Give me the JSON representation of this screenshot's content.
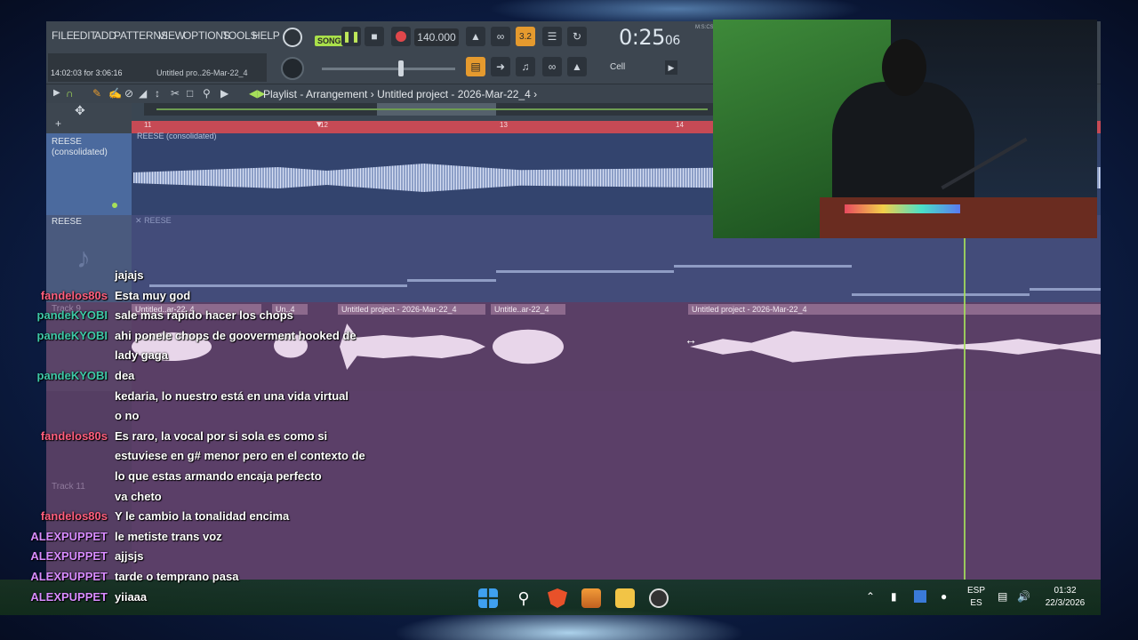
{
  "menu": [
    "FILE",
    "EDIT",
    "ADD",
    "PATTERNS",
    "VIEW",
    "OPTIONS",
    "TOOLS",
    "HELP"
  ],
  "transport": {
    "pat_song_label": "SONG",
    "tempo": "140.000",
    "time": "0:25",
    "time_sub": "06",
    "time_units": "M:S:CS",
    "pattern_step": "3.2",
    "snap": "Cell"
  },
  "hint": {
    "time_range": "14:02:03 for 3:06:16",
    "file": "Untitled pro..26-Mar-22_4"
  },
  "playlist": {
    "title": "Playlist - Arrangement",
    "crumb": "Untitled project - 2026-Mar-22_4"
  },
  "ruler": [
    "11",
    "12",
    "13",
    "14"
  ],
  "tracks": [
    {
      "name": "REESE",
      "sub": "(consolidated)",
      "clip": "REESE (consolidated)"
    },
    {
      "name": "REESE",
      "clip": "REESE"
    },
    {
      "name": "Track 9"
    },
    {
      "name": "Track 11"
    }
  ],
  "clips_vocal": [
    "Untitled..ar-22_4",
    "Un..4",
    "Untitled project - 2026-Mar-22_4",
    "Untitle..ar-22_4",
    "Untitled project - 2026-Mar-22_4"
  ],
  "chat": [
    {
      "user": "",
      "msg": "jajajs",
      "color": "#ffffff"
    },
    {
      "user": "fandelos80s",
      "msg": "Esta muy god",
      "color": "#ff5f7e"
    },
    {
      "user": "pandeKYOBI",
      "msg": "sale mas rapido hacer los chops",
      "color": "#3ec9a7"
    },
    {
      "user": "pandeKYOBI",
      "msg": "ahi ponele chops de gooverment hooked de",
      "color": "#3ec9a7"
    },
    {
      "user": "",
      "msg": "lady gaga",
      "color": "#ffffff"
    },
    {
      "user": "pandeKYOBI",
      "msg": "dea",
      "color": "#3ec9a7"
    },
    {
      "user": "",
      "msg": "kedaria, lo nuestro está en una vida virtual",
      "color": "#c9273f"
    },
    {
      "user": "",
      "msg": "o no",
      "color": "#c9273f"
    },
    {
      "user": "fandelos80s",
      "msg": "Es raro, la vocal por si sola es como si",
      "color": "#ff5f7e"
    },
    {
      "user": "",
      "msg": "estuviese en g# menor pero en el contexto de",
      "color": "#ffffff"
    },
    {
      "user": "",
      "msg": "lo que estas armando encaja perfecto",
      "color": "#ffffff"
    },
    {
      "user": "",
      "msg": "va cheto",
      "color": "#c9273f"
    },
    {
      "user": "fandelos80s",
      "msg": "Y le cambio la tonalidad encima",
      "color": "#ff5f7e"
    },
    {
      "user": "ALEXPUPPET",
      "msg": "le metiste trans voz",
      "color": "#d88cff"
    },
    {
      "user": "ALEXPUPPET",
      "msg": "ajjsjs",
      "color": "#d88cff"
    },
    {
      "user": "ALEXPUPPET",
      "msg": "tarde o temprano pasa",
      "color": "#d88cff"
    },
    {
      "user": "ALEXPUPPET",
      "msg": "yiiaaa",
      "color": "#d88cff"
    }
  ],
  "taskbar": {
    "lang_top": "ESP",
    "lang_bottom": "ES",
    "time": "01:32",
    "date": "22/3/2026",
    "icons": [
      "windows-start-icon",
      "search-icon",
      "brave-browser-icon",
      "fl-studio-icon",
      "file-explorer-icon",
      "obs-icon"
    ]
  }
}
